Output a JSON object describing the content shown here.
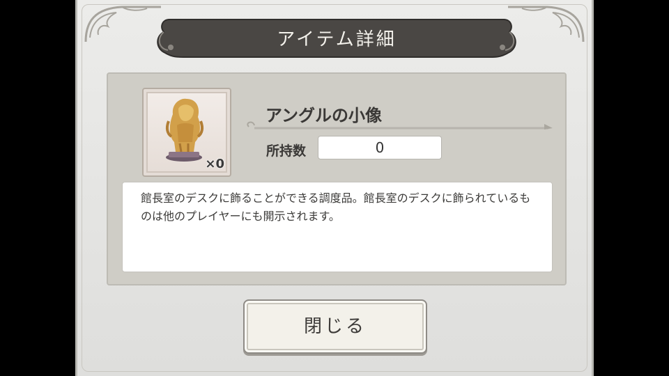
{
  "dialog": {
    "title": "アイテム詳細",
    "item": {
      "name": "アングルの小像",
      "badge_quantity": "×0",
      "owned_label": "所持数",
      "owned_count": "0",
      "icon": "golden-figurine-icon"
    },
    "description": "館長室のデスクに飾ることができる調度品。館長室のデスクに飾られているものは他のプレイヤーにも開示されます。",
    "close_button": "閉じる"
  },
  "colors": {
    "banner": "#4a4744",
    "panel": "#cfcdc6",
    "frame": "#e6e5e1",
    "figurine": "#d2a04a"
  }
}
